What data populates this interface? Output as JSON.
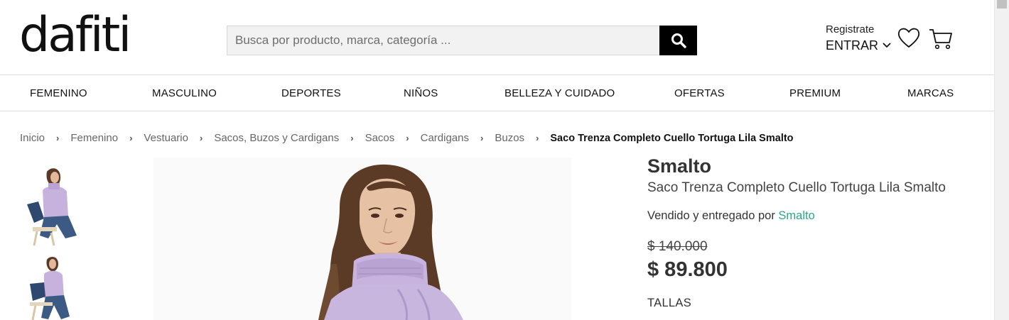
{
  "header": {
    "logo": "dafiti",
    "search_placeholder": "Busca por producto, marca, categoría ...",
    "account_register": "Registrate",
    "account_login": "ENTRAR"
  },
  "nav": {
    "items": [
      "FEMENINO",
      "MASCULINO",
      "DEPORTES",
      "NIÑOS",
      "BELLEZA Y CUIDADO",
      "OFERTAS",
      "PREMIUM",
      "MARCAS"
    ]
  },
  "breadcrumb": {
    "items": [
      "Inicio",
      "Femenino",
      "Vestuario",
      "Sacos, Buzos y Cardigans",
      "Sacos",
      "Cardigans",
      "Buzos"
    ],
    "current": "Saco Trenza Completo Cuello Tortuga Lila Smalto"
  },
  "product": {
    "brand": "Smalto",
    "name": "Saco Trenza Completo Cuello Tortuga Lila Smalto",
    "sold_by_prefix": "Vendido y entregado por ",
    "seller": "Smalto",
    "old_price": "$ 140.000",
    "price": "$ 89.800",
    "sizes_label": "TALLAS"
  },
  "colors": {
    "accent_seller": "#2aa68f",
    "sweater": "#c6b2dc",
    "search_button": "#000000"
  }
}
